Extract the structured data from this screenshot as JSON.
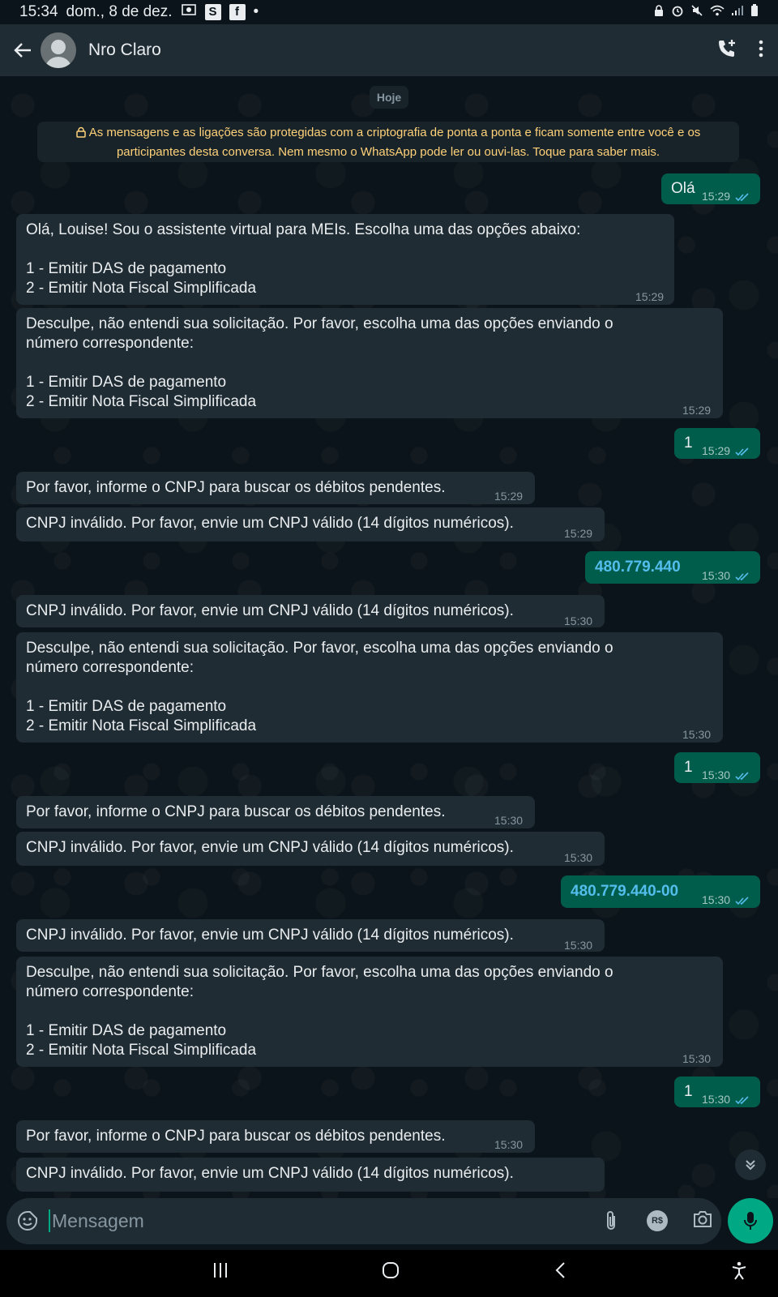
{
  "status_bar": {
    "time": "15:34",
    "date": "dom., 8 de dez."
  },
  "header": {
    "contact_name": "Nro Claro"
  },
  "chat": {
    "date_label": "Hoje",
    "e2e_notice": "As mensagens e as ligações são protegidas com a criptografia de ponta a ponta e ficam somente entre você e os participantes desta conversa. Nem mesmo o WhatsApp pode ler ou ouvi-las. Toque para saber mais.",
    "messages": [
      {
        "dir": "out",
        "text": "Olá",
        "time": "15:29"
      },
      {
        "dir": "in",
        "text": "Olá, Louise! Sou o assistente virtual para MEIs. Escolha uma das opções abaixo:\n\n1 - Emitir DAS de pagamento\n2 - Emitir Nota Fiscal Simplificada",
        "time": "15:29"
      },
      {
        "dir": "in",
        "text": "Desculpe, não entendi sua solicitação. Por favor, escolha uma das opções enviando o\nnúmero correspondente:\n\n1 - Emitir DAS de pagamento\n2 - Emitir Nota Fiscal Simplificada",
        "time": "15:29"
      },
      {
        "dir": "out",
        "text": "1",
        "time": "15:29"
      },
      {
        "dir": "in",
        "text": "Por favor, informe o CNPJ para buscar os débitos pendentes.",
        "time": "15:29"
      },
      {
        "dir": "in",
        "text": "CNPJ inválido. Por favor, envie um CNPJ válido (14 dígitos numéricos).",
        "time": "15:29"
      },
      {
        "dir": "out",
        "text": "480.779.440",
        "time": "15:30"
      },
      {
        "dir": "in",
        "text": "CNPJ inválido. Por favor, envie um CNPJ válido (14 dígitos numéricos).",
        "time": "15:30"
      },
      {
        "dir": "in",
        "text": "Desculpe, não entendi sua solicitação. Por favor, escolha uma das opções enviando o\nnúmero correspondente:\n\n1 - Emitir DAS de pagamento\n2 - Emitir Nota Fiscal Simplificada",
        "time": "15:30"
      },
      {
        "dir": "out",
        "text": "1",
        "time": "15:30"
      },
      {
        "dir": "in",
        "text": "Por favor, informe o CNPJ para buscar os débitos pendentes.",
        "time": "15:30"
      },
      {
        "dir": "in",
        "text": "CNPJ inválido. Por favor, envie um CNPJ válido (14 dígitos numéricos).",
        "time": "15:30"
      },
      {
        "dir": "out",
        "text": "480.779.440-00",
        "time": "15:30"
      },
      {
        "dir": "in",
        "text": "CNPJ inválido. Por favor, envie um CNPJ válido (14 dígitos numéricos).",
        "time": "15:30"
      },
      {
        "dir": "in",
        "text": "Desculpe, não entendi sua solicitação. Por favor, escolha uma das opções enviando o\nnúmero correspondente:\n\n1 - Emitir DAS de pagamento\n2 - Emitir Nota Fiscal Simplificada",
        "time": "15:30"
      },
      {
        "dir": "out",
        "text": "1",
        "time": "15:30"
      },
      {
        "dir": "in",
        "text": "Por favor, informe o CNPJ para buscar os débitos pendentes.",
        "time": "15:30"
      },
      {
        "dir": "in",
        "text": "CNPJ inválido. Por favor, envie um CNPJ válido (14 dígitos numéricos).",
        "time": ""
      }
    ]
  },
  "composer": {
    "placeholder": "Mensagem",
    "currency_badge": "R$"
  },
  "colors": {
    "accent": "#00a884",
    "outgoing_bubble": "#005c4b",
    "incoming_bubble": "#202c33",
    "read_ticks": "#53bdeb",
    "e2e_text": "#ffd279"
  }
}
